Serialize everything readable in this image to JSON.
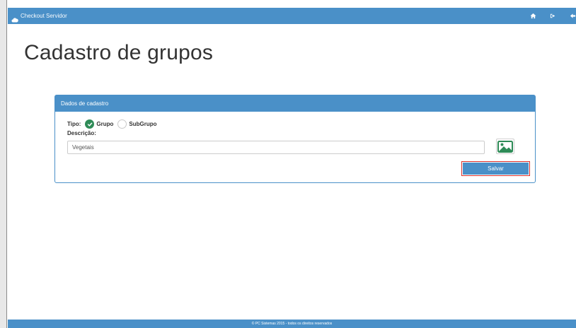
{
  "app": {
    "title": "Checkout Servidor",
    "icon": "cloud-icon"
  },
  "nav": {
    "icons": [
      "home-icon",
      "logout-icon",
      "back-icon"
    ]
  },
  "page": {
    "title": "Cadastro de grupos"
  },
  "panel": {
    "heading": "Dados de cadastro",
    "tipo_label": "Tipo:",
    "options": [
      {
        "label": "Grupo",
        "selected": true
      },
      {
        "label": "SubGrupo",
        "selected": false
      }
    ],
    "descricao_label": "Descrição:",
    "descricao_value": "Vegetais",
    "image_icon": "image-icon",
    "save_label": "Salvar"
  },
  "footer": {
    "text": "© PC Sistemas 2015 - todos os direitos reservados"
  },
  "colors": {
    "primary": "#4a90c8",
    "success": "#2e8b57",
    "highlight": "#d9302a"
  }
}
